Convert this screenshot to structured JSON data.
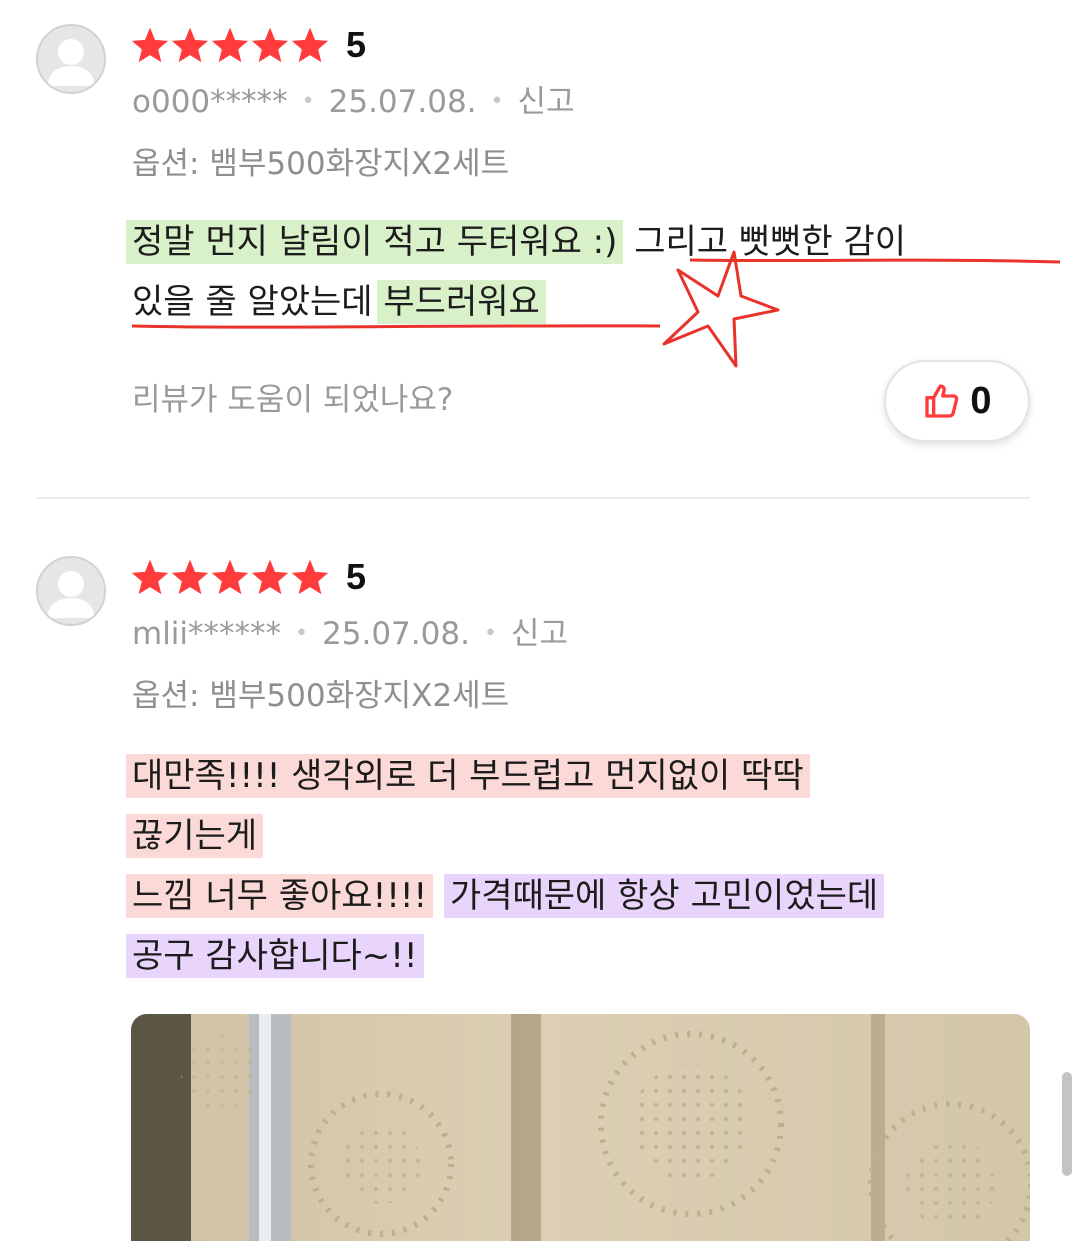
{
  "reviews": [
    {
      "rating": "5",
      "username": "o000*****",
      "date": "25.07.08.",
      "report_label": "신고",
      "option": "옵션: 뱀부500화장지X2세트",
      "content": {
        "line1_hl": "정말 먼지 날림이 적고 두터워요 :)",
        "line1_rest": " 그리고 뻣뻣한 감이",
        "line2_plain": "있을 줄 알았는데 ",
        "line2_hl": "부드러워요"
      },
      "helpful_question": "리뷰가 도움이 되었나요?",
      "like_count": "0"
    },
    {
      "rating": "5",
      "username": "mlii******",
      "date": "25.07.08.",
      "report_label": "신고",
      "option": "옵션: 뱀부500화장지X2세트",
      "content": {
        "line1": "대만족!!!! 생각외로 더 부드럽고 먼지없이 딱딱",
        "line2": "끊기는게",
        "line3_red": "느낌 너무 좋아요!!!!",
        "line3_purple": "가격때문에 항상 고민이었는데",
        "line4": "공구 감사합니다~!!"
      }
    }
  ],
  "icons": {
    "star": "star-icon",
    "avatar": "default-user-avatar-icon",
    "like": "thumbs-up-icon"
  },
  "colors": {
    "star": "#ff3b3b",
    "highlight_green": "#d9f1c9",
    "highlight_red": "#fbd9d7",
    "highlight_purple": "#e9d5fb",
    "annotation_red": "#e8322a",
    "like_icon": "#ff3b3b"
  }
}
